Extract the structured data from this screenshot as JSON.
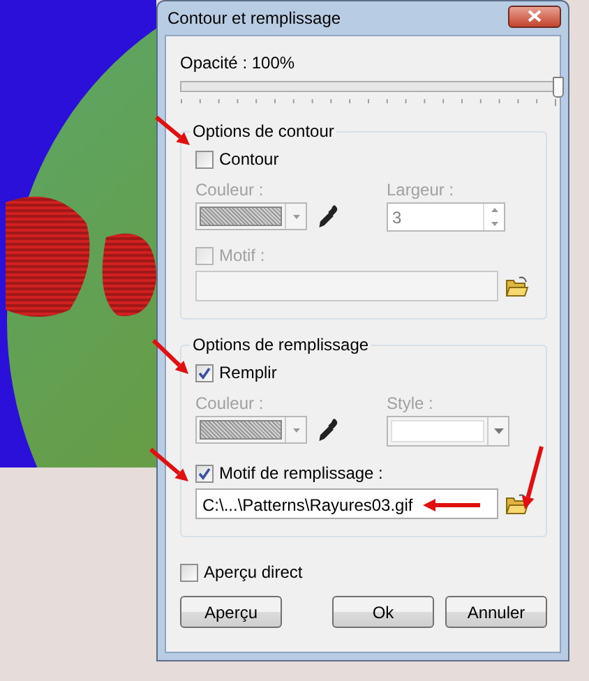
{
  "window": {
    "title": "Contour et remplissage"
  },
  "opacity": {
    "label": "Opacité : 100%",
    "level": 1
  },
  "stroke_options": {
    "title": "Options de contour",
    "enabled": {
      "label": "Contour",
      "checked": false
    },
    "color_label": "Couleur :",
    "width_label": "Largeur :",
    "width_value": "3",
    "pattern": {
      "label": "Motif :",
      "checked": false,
      "disabled": true
    }
  },
  "fill_options": {
    "title": "Options de remplissage",
    "enabled": {
      "label": "Remplir",
      "checked": true
    },
    "color_label": "Couleur :",
    "style_label": "Style :",
    "pattern": {
      "label": "Motif de remplissage :",
      "checked": true,
      "disabled": false,
      "value": "C:\\...\\Patterns\\Rayures03.gif"
    }
  },
  "live_preview": {
    "label": "Aperçu direct",
    "checked": false
  },
  "buttons": [
    "Aperçu",
    "Ok",
    "Annuler"
  ]
}
